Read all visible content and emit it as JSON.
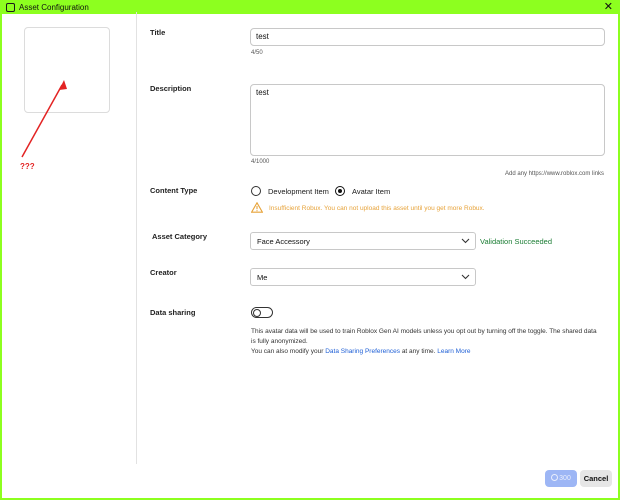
{
  "window": {
    "title": "Asset Configuration",
    "close_glyph": "✕"
  },
  "annotation": {
    "text": "???",
    "color": "#e32323"
  },
  "form": {
    "title": {
      "label": "Title",
      "value": "test",
      "counter": "4/50"
    },
    "description": {
      "label": "Description",
      "value": "test",
      "counter": "4/1000",
      "hint": "Add any https://www.roblox.com links"
    },
    "content_type": {
      "label": "Content Type",
      "options": [
        "Development Item",
        "Avatar Item"
      ],
      "selected": "Avatar Item",
      "warning": "Insufficient Robux. You can not upload this asset until you get more Robux."
    },
    "asset_category": {
      "label": "Asset Category",
      "value": "Face Accessory",
      "status": "Validation Succeeded"
    },
    "creator": {
      "label": "Creator",
      "value": "Me"
    },
    "data_sharing": {
      "label": "Data sharing",
      "enabled": false,
      "description": "This avatar data will be used to train Roblox Gen AI models unless you opt out by turning off the toggle. The shared data is fully anonymized.",
      "modify_prefix": "You can also modify your",
      "preferences_link": "Data Sharing Preferences",
      "modify_suffix": "at any time.",
      "learn_more": "Learn More"
    }
  },
  "footer": {
    "buy_amount": "300",
    "cancel_label": "Cancel"
  },
  "colors": {
    "accent": "#8dff1f",
    "link": "#1e5fd6",
    "warning": "#e7a33a",
    "success": "#1b7d34",
    "buy_disabled": "#9db6f5"
  }
}
